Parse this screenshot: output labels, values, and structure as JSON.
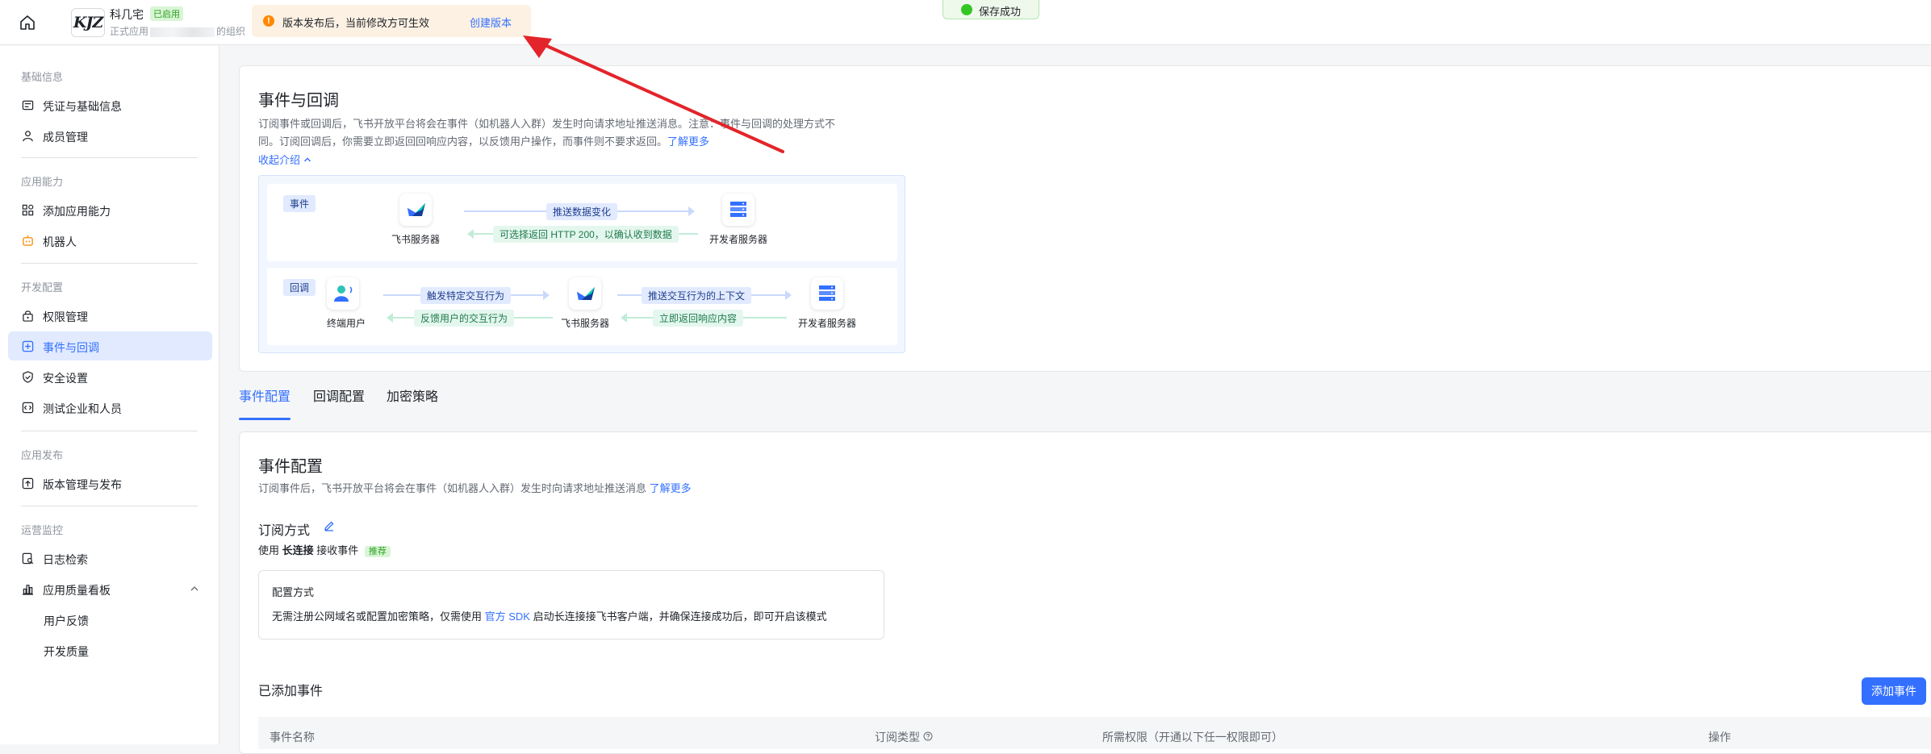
{
  "topbar": {
    "app_logo_text": "KJZ",
    "app_name": "科几宅",
    "app_status": "已启用",
    "app_org_prefix": "正式应用",
    "app_org_suffix": "的组织",
    "notice_text": "版本发布后，当前修改方可生效",
    "notice_link": "创建版本",
    "toast_text": "保存成功"
  },
  "sidebar": {
    "sections": [
      {
        "title": "基础信息",
        "items": [
          {
            "label": "凭证与基础信息",
            "icon": "credential-icon"
          },
          {
            "label": "成员管理",
            "icon": "member-icon"
          }
        ]
      },
      {
        "title": "应用能力",
        "items": [
          {
            "label": "添加应用能力",
            "icon": "apps-icon"
          },
          {
            "label": "机器人",
            "icon": "robot-icon"
          }
        ]
      },
      {
        "title": "开发配置",
        "items": [
          {
            "label": "权限管理",
            "icon": "lock-icon"
          },
          {
            "label": "事件与回调",
            "icon": "event-icon"
          },
          {
            "label": "安全设置",
            "icon": "shield-icon"
          },
          {
            "label": "测试企业和人员",
            "icon": "code-icon"
          }
        ]
      },
      {
        "title": "应用发布",
        "items": [
          {
            "label": "版本管理与发布",
            "icon": "upload-icon"
          }
        ]
      },
      {
        "title": "运营监控",
        "items": [
          {
            "label": "日志检索",
            "icon": "log-icon"
          },
          {
            "label": "应用质量看板",
            "icon": "chart-icon"
          },
          {
            "label": "用户反馈"
          },
          {
            "label": "开发质量"
          }
        ]
      }
    ],
    "active": "事件与回调"
  },
  "intro": {
    "title": "事件与回调",
    "desc_line1": "订阅事件或回调后，飞书开放平台将会在事件（如机器人入群）发生时向请求地址推送消息。注意：事件与回调的处理方式不",
    "desc_line2": "同。订阅回调后，你需要立即返回回响应内容，以反馈用户操作，而事件则不要求返回。",
    "learn_more": "了解更多",
    "collapse": "收起介绍",
    "diagram": {
      "event_tag": "事件",
      "callback_tag": "回调",
      "feishu_server": "飞书服务器",
      "dev_server": "开发者服务器",
      "end_user": "终端用户",
      "push_data": "推送数据变化",
      "optional_return": "可选择返回 HTTP 200，以确认收到数据",
      "trigger": "触发特定交互行为",
      "feedback": "反馈用户的交互行为",
      "push_context": "推送交互行为的上下文",
      "return_now": "立即返回响应内容"
    }
  },
  "tabs": [
    {
      "label": "事件配置"
    },
    {
      "label": "回调配置"
    },
    {
      "label": "加密策略"
    }
  ],
  "event_config": {
    "title": "事件配置",
    "desc": "订阅事件后，飞书开放平台将会在事件（如机器人入群）发生时向请求地址推送消息",
    "learn_more": "了解更多",
    "sub_method_title": "订阅方式",
    "use": "使用",
    "long_conn": "长连接",
    "receive": "接收事件",
    "recommended": "推荐",
    "config_title": "配置方式",
    "config_desc_1": "无需注册公网域名或配置加密策略，仅需使用",
    "config_sdk": "官方 SDK",
    "config_desc_2": "启动长连接接飞书客户端，并确保连接成功后，即可开启该模式",
    "added_events": "已添加事件",
    "add_button": "添加事件",
    "columns": [
      "事件名称",
      "订阅类型",
      "所需权限（开通以下任一权限即可）",
      "操作"
    ]
  },
  "colors": {
    "accent": "#3370ff",
    "warn": "#ff8800",
    "success": "#34c724",
    "annotation": "#e3242b"
  }
}
